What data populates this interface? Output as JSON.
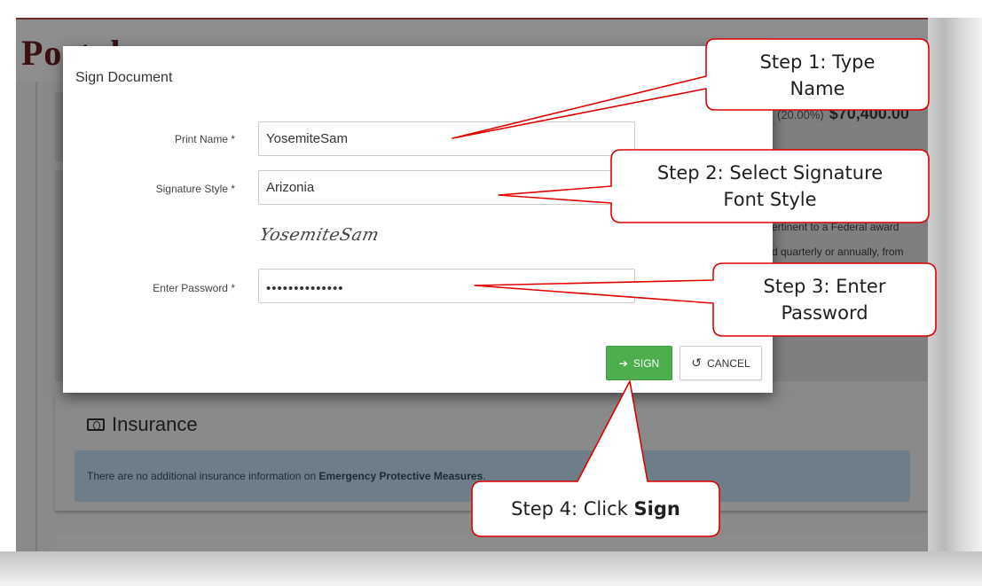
{
  "page": {
    "portal_title": "Portal",
    "bg_amount_pct": "(20.00%)",
    "bg_amount": "$70,400.00",
    "bg_text_1": "ertinent to a Federal award",
    "bg_text_2": "d quarterly or annually, from"
  },
  "insurance": {
    "title": "Insurance",
    "alert_prefix": "There are no additional insurance information on ",
    "alert_bold": "Emergency Protective Measures",
    "alert_suffix": "."
  },
  "modal": {
    "title": "Sign Document",
    "print_name_label": "Print Name *",
    "print_name_value": "YosemiteSam",
    "signature_style_label": "Signature Style *",
    "signature_style_value": "Arizonia",
    "signature_preview": "YosemiteSam",
    "password_label": "Enter Password *",
    "password_dots": "••••••••••••••",
    "sign_label": "SIGN",
    "cancel_label": "CANCEL"
  },
  "callouts": {
    "step1_line1": "Step 1: Type",
    "step1_line2": "Name",
    "step2_line1": "Step 2: Select Signature",
    "step2_line2": "Font Style",
    "step3_line1": "Step 3: Enter",
    "step3_line2": "Password",
    "step4_prefix": "Step 4: Click ",
    "step4_bold": "Sign"
  },
  "colors": {
    "sign_button": "#4cae4c",
    "callout_border": "#e00000",
    "portal_title": "#3a1010"
  }
}
